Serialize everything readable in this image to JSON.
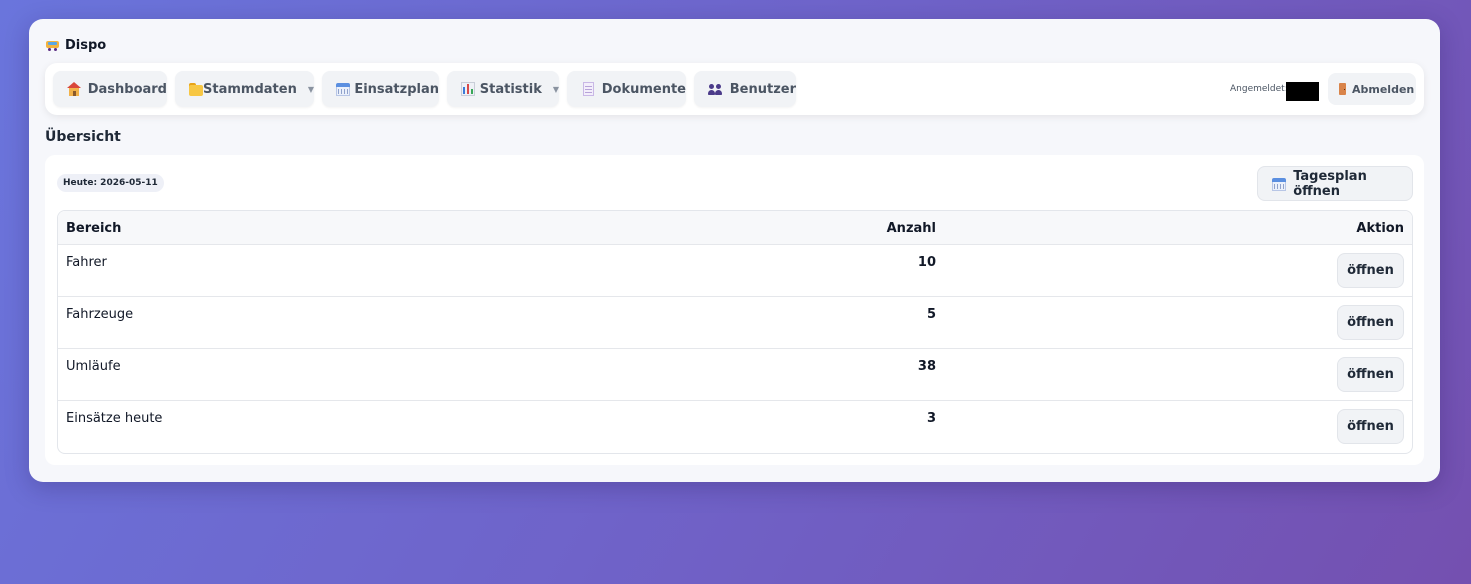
{
  "brand": {
    "icon": "bus-icon",
    "title": "Dispo"
  },
  "nav": {
    "items": [
      {
        "label": "Dashboard",
        "icon": "house-icon",
        "dropdown": false
      },
      {
        "label": "Stammdaten",
        "icon": "folder-icon",
        "dropdown": true
      },
      {
        "label": "Einsatzplan",
        "icon": "calendar-icon",
        "dropdown": false
      },
      {
        "label": "Statistik",
        "icon": "bar-chart-icon",
        "dropdown": true
      },
      {
        "label": "Dokumente",
        "icon": "document-icon",
        "dropdown": false
      },
      {
        "label": "Benutzer",
        "icon": "users-icon",
        "dropdown": false
      }
    ],
    "login_label": "Angemeldet:",
    "logout_label": "Abmelden"
  },
  "overview": {
    "title": "Übersicht",
    "date_badge": "Heute: 2026-05-11",
    "tagesplan_button": "Tagesplan öffnen",
    "table": {
      "headers": [
        "Bereich",
        "Anzahl",
        "Aktion"
      ],
      "rows": [
        {
          "bereich": "Fahrer",
          "anzahl": "10",
          "aktion": "öffnen"
        },
        {
          "bereich": "Fahrzeuge",
          "anzahl": "5",
          "aktion": "öffnen"
        },
        {
          "bereich": "Umläufe",
          "anzahl": "38",
          "aktion": "öffnen"
        },
        {
          "bereich": "Einsätze heute",
          "anzahl": "3",
          "aktion": "öffnen"
        }
      ]
    }
  }
}
